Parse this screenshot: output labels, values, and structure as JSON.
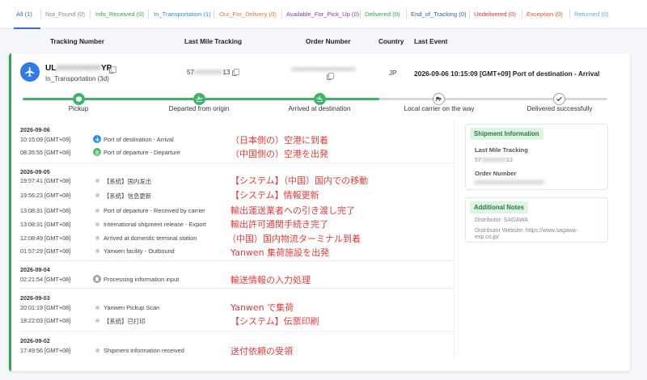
{
  "tabs": [
    {
      "label": "All",
      "count": "(1)",
      "color": "#2f6fd6",
      "active": true
    },
    {
      "label": "Not_Found",
      "count": "(0)",
      "color": "#888888"
    },
    {
      "label": "Info_Received",
      "count": "(0)",
      "color": "#2fa84f"
    },
    {
      "label": "In_Transportation",
      "count": "(1)",
      "color": "#2f8fd6"
    },
    {
      "label": "Out_For_Delivery",
      "count": "(0)",
      "color": "#e8793a"
    },
    {
      "label": "Available_For_Pick_Up",
      "count": "(0)",
      "color": "#7b3fb6"
    },
    {
      "label": "Delivered",
      "count": "(0)",
      "color": "#2fa84f"
    },
    {
      "label": "End_of_Tracking",
      "count": "(0)",
      "color": "#2a6a8a"
    },
    {
      "label": "Undelivered",
      "count": "(0)",
      "color": "#d63a3a"
    },
    {
      "label": "Exception",
      "count": "(0)",
      "color": "#e05a1a"
    },
    {
      "label": "Returned",
      "count": "(0)",
      "color": "#5ab0c8"
    }
  ],
  "columns": {
    "tracking_number": "Tracking Number",
    "last_mile": "Last Mile Tracking",
    "order_number": "Order Number",
    "country": "Country",
    "last_event": "Last Event"
  },
  "shipment": {
    "tracking_prefix": "UL",
    "tracking_hidden": "##########",
    "tracking_suffix": "YP",
    "status": "In_Transportation",
    "days": "(3d)",
    "last_mile_prefix": "57",
    "last_mile_hidden": "########",
    "last_mile_suffix": "13",
    "order_hidden": "###################",
    "country": "JP",
    "last_event": "2026-09-06 10:15:09 [GMT+09] Port of destination - Arrival"
  },
  "progress": {
    "fraction": 0.61,
    "stages": [
      {
        "label": "Pickup",
        "done": true,
        "icon": "box-icon"
      },
      {
        "label": "Departed from origin",
        "done": true,
        "icon": "plane-depart-icon"
      },
      {
        "label": "Arrived at destination",
        "done": true,
        "icon": "plane-arrive-icon"
      },
      {
        "label": "Local carrier on the way",
        "done": false,
        "icon": "truck-icon"
      },
      {
        "label": "Delivered successfully",
        "done": false,
        "icon": "check-icon"
      }
    ]
  },
  "events": {
    "d1": {
      "date": "2026-09-06",
      "e1": {
        "time": "10:15:09 [GMT+09]",
        "desc": "Port of destination - Arrival",
        "note": "（日本側の）空港に到着"
      },
      "e2": {
        "time": "08:35:55 [GMT+08]",
        "desc": "Port of departure - Departure",
        "note": "（中国側の）空港を出発"
      }
    },
    "d2": {
      "date": "2026-09-05",
      "e1": {
        "time": "19:57:41 [GMT+08]",
        "desc": "【系统】国内发出",
        "note": "【システム】（中国）国内での移動"
      },
      "e2": {
        "time": "19:56:23 [GMT+08]",
        "desc": "【系统】信息更新",
        "note": "【システム】情報更新"
      },
      "e3": {
        "time": "13:08:31 [GMT+08]",
        "desc": "Port of departure - Received by carrier",
        "note": "輸出運送業者への引き渡し完了"
      },
      "e4": {
        "time": "13:08:31 [GMT+08]",
        "desc": "International shipment release - Export",
        "note": "輸出許可通関手続き完了"
      },
      "e5": {
        "time": "12:08:49 [GMT+08]",
        "desc": "Arrived at domestic terminal station",
        "note": "（中国）国内物流ターミナル到着"
      },
      "e6": {
        "time": "01:57:29 [GMT+08]",
        "desc": "Yanwen facility - Outbound",
        "note": "Yanwen 集荷施設を出発"
      }
    },
    "d3": {
      "date": "2026-09-04",
      "e1": {
        "time": "02:21:54 [GMT+08]",
        "desc": "Processing information input",
        "note": "輸送情報の入力処理"
      }
    },
    "d4": {
      "date": "2026-09-03",
      "e1": {
        "time": "20:01:19 [GMT+08]",
        "desc": "Yanwen Pickup Scan",
        "note": "Yanwen で集荷"
      },
      "e2": {
        "time": "18:22:03 [GMT+08]",
        "desc": "【系统】已打印",
        "note": "【システム】伝票印刷"
      }
    },
    "d5": {
      "date": "2026-09-02",
      "e1": {
        "time": "17:49:56 [GMT+08]",
        "desc": "Shipment information received",
        "note": "送付依頼の受領"
      }
    }
  },
  "side": {
    "shipment_title": "Shipment Information",
    "last_mile_label": "Last Mile Tracking",
    "last_mile_value_prefix": "57",
    "last_mile_value_hidden": "########",
    "last_mile_value_suffix": "13",
    "order_label": "Order Number",
    "order_value_hidden": "######################",
    "notes_title": "Additional Notes",
    "distributor": "Distributor: SAGAWA",
    "website_line1": "Distributor Website: https://www.sagawa-",
    "website_line2": "exp.co.jp/"
  }
}
